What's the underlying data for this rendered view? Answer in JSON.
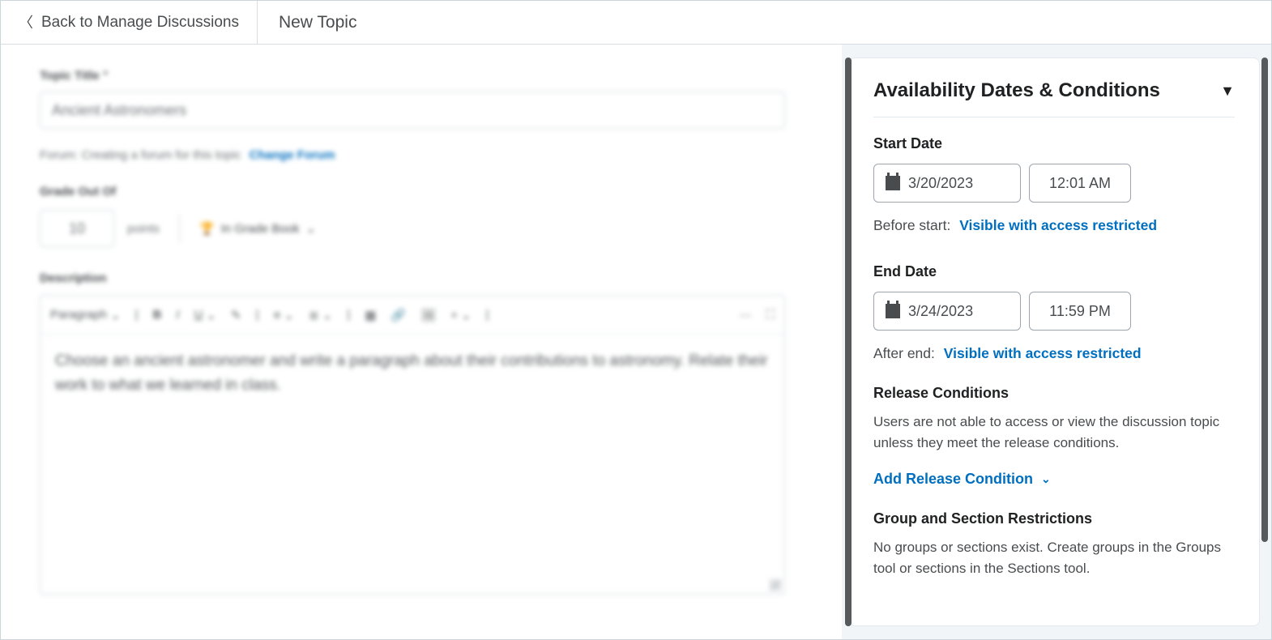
{
  "header": {
    "back_label": "Back to Manage Discussions",
    "page_title": "New Topic"
  },
  "form": {
    "title_label": "Topic Title",
    "title_required_mark": "*",
    "title_value": "Ancient Astronomers",
    "forum_prefix": "Forum:",
    "forum_status": "Creating a forum for this topic",
    "change_forum_label": "Change Forum",
    "grade_label": "Grade Out Of",
    "grade_value": "10",
    "grade_points_label": "points",
    "in_gradebook_label": "In Grade Book",
    "description_label": "Description",
    "editor_toolbar": {
      "paragraph": "Paragraph",
      "bold": "B",
      "italic": "I",
      "underline": "U"
    },
    "description_body": "Choose an ancient astronomer and write a paragraph about their contributions to astronomy. Relate their work to what we learned in class."
  },
  "side": {
    "panel_title": "Availability Dates & Conditions",
    "start_label": "Start Date",
    "start_date": "3/20/2023",
    "start_time": "12:01 AM",
    "before_start_prefix": "Before start:",
    "before_start_link": "Visible with access restricted",
    "end_label": "End Date",
    "end_date": "3/24/2023",
    "end_time": "11:59 PM",
    "after_end_prefix": "After end:",
    "after_end_link": "Visible with access restricted",
    "release_heading": "Release Conditions",
    "release_desc": "Users are not able to access or view the discussion topic unless they meet the release conditions.",
    "add_release_label": "Add Release Condition",
    "group_heading": "Group and Section Restrictions",
    "group_desc": "No groups or sections exist. Create groups in the Groups tool or sections in the Sections tool."
  }
}
